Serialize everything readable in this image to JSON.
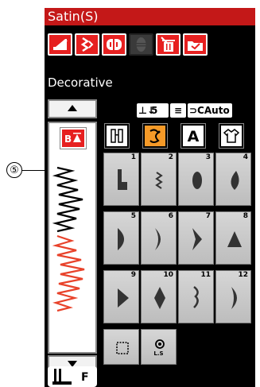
{
  "title": "Satin(S)",
  "mode_label": "Decorative",
  "toolbar": [
    {
      "name": "stitch-length-icon",
      "enabled": true
    },
    {
      "name": "pattern-edit-icon",
      "enabled": true
    },
    {
      "name": "mirror-icon",
      "enabled": true
    },
    {
      "name": "elongation-icon",
      "enabled": false
    },
    {
      "name": "delete-icon",
      "enabled": true
    },
    {
      "name": "open-folder-icon",
      "enabled": true
    }
  ],
  "status": {
    "presser_value": "5",
    "auto_label": "Auto"
  },
  "callout": "⑤",
  "categories": [
    {
      "name": "utility-icon",
      "selected": false
    },
    {
      "name": "decorative-icon",
      "selected": true
    },
    {
      "name": "lettering-icon",
      "selected": false,
      "glyph": "A"
    },
    {
      "name": "quilt-shirt-icon",
      "selected": false
    }
  ],
  "patterns": [
    {
      "num": "1",
      "shape": "step"
    },
    {
      "num": "2",
      "shape": "zigzag"
    },
    {
      "num": "3",
      "shape": "oval"
    },
    {
      "num": "4",
      "shape": "leaf"
    },
    {
      "num": "5",
      "shape": "half-moon"
    },
    {
      "num": "6",
      "shape": "crescent"
    },
    {
      "num": "7",
      "shape": "chevron"
    },
    {
      "num": "8",
      "shape": "triangle"
    },
    {
      "num": "9",
      "shape": "arrow"
    },
    {
      "num": "10",
      "shape": "diamond"
    },
    {
      "num": "11",
      "shape": "wave"
    },
    {
      "num": "12",
      "shape": "crescent-right"
    }
  ],
  "extra_buttons": [
    {
      "name": "frame-icon"
    },
    {
      "name": "lock-stitch-icon",
      "label": "L.S"
    }
  ],
  "footer": {
    "foot_label": "F"
  },
  "colors": {
    "accent": "#e62020",
    "title_bar": "#c41818",
    "selected": "#f59a28"
  }
}
